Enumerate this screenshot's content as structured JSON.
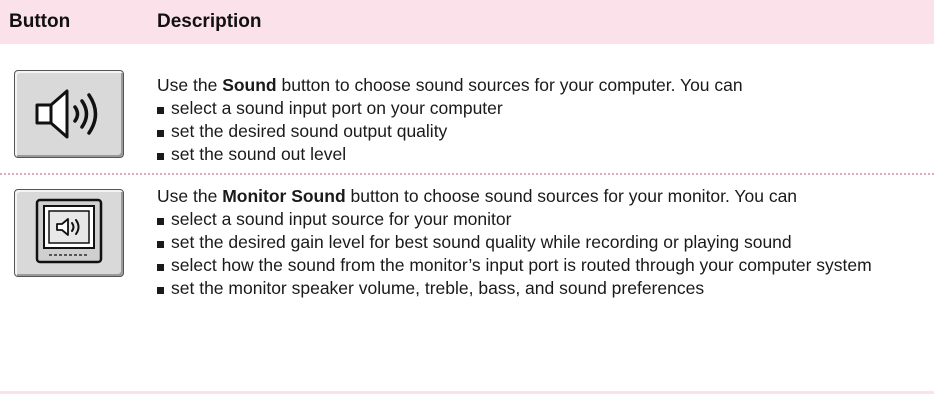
{
  "header": {
    "button_col": "Button",
    "description_col": "Description"
  },
  "rows": [
    {
      "icon": "speaker-sound-icon",
      "intro_prefix": "Use the ",
      "intro_bold": "Sound",
      "intro_suffix": " button to choose sound sources for your computer. You can",
      "bullets": [
        "select a sound input port on your computer",
        "set the desired sound output quality",
        "set the sound out level"
      ]
    },
    {
      "icon": "monitor-sound-icon",
      "intro_prefix": "Use the ",
      "intro_bold": "Monitor Sound",
      "intro_suffix": " button to choose sound sources for your monitor. You can",
      "bullets": [
        "select a sound input source for your monitor",
        "set the desired gain level for best sound quality while recording or playing sound",
        "select how the sound from the monitor’s input port is routed through your computer system",
        "set the monitor speaker volume, treble, bass, and sound preferences"
      ]
    }
  ],
  "colors": {
    "header_bg": "#fbe1e9",
    "divider": "#e0a9b8"
  }
}
